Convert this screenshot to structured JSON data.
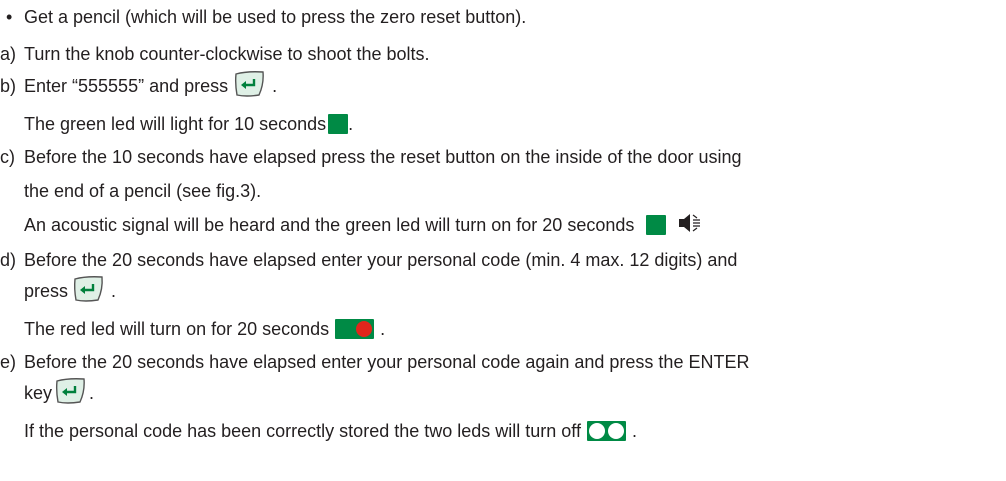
{
  "bullet": {
    "marker": "•",
    "text": "Get a pencil (which will be used to press the zero reset button)."
  },
  "steps": {
    "a": {
      "marker": "a)",
      "line1": "Turn the knob counter-clockwise to shoot the bolts."
    },
    "b": {
      "marker": "b)",
      "line1": "Enter “555555” and press",
      "line1_end": ".",
      "line2": "The green led will light for 10 seconds",
      "line2_end": "."
    },
    "c": {
      "marker": "c)",
      "line1": "Before the 10 seconds have elapsed press the reset button on the inside of the door using",
      "line2": "the end of a pencil (see fig.3).",
      "line3": "An  acoustic  signal  will be heard  and  the  green  led will turn on for 20 seconds"
    },
    "d": {
      "marker": "d)",
      "line1": "Before the 20 seconds have elapsed enter your personal code (min. 4  max. 12 digits) and",
      "line2": "press",
      "line2_end": ".",
      "line3": "The red led will turn on for 20 seconds",
      "line3_end": "."
    },
    "e": {
      "marker": "e)",
      "line1": "Before the 20 seconds have elapsed enter your personal code again and press the ENTER",
      "line2": "key",
      "line2_end": ".",
      "line3": "If the personal code has been correctly stored the two leds will turn off",
      "line3_end": "."
    }
  },
  "icons": {
    "enter_key": "enter-key-icon",
    "green_led": "green-led-icon",
    "speaker": "speaker-icon",
    "green_red_leds": "green-red-leds-icon",
    "leds_off": "leds-off-icon"
  },
  "colors": {
    "text": "#231f20",
    "led_frame": "#008a45",
    "green_led": "#008a45",
    "red_led": "#e1261c",
    "off_led": "#ffffff",
    "enter_key_fill": "#dff0e6",
    "enter_key_arrow": "#00803c"
  }
}
